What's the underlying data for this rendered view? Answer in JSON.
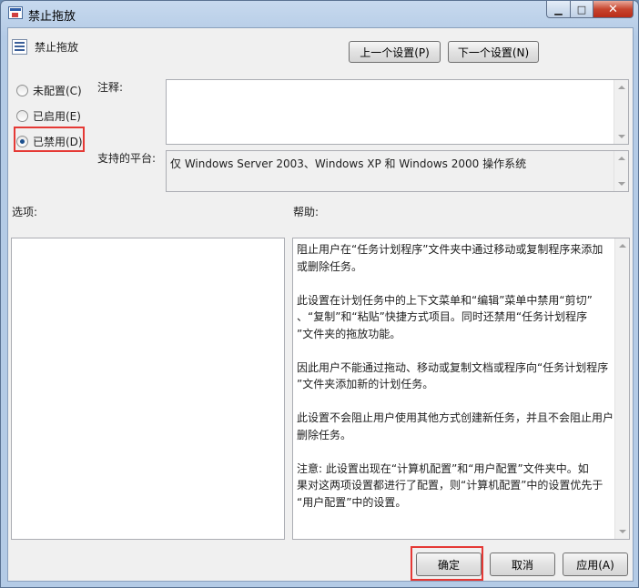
{
  "window": {
    "title": "禁止拖放",
    "minimize_glyph": "▁",
    "maximize_glyph": "□",
    "close_glyph": "✕"
  },
  "policy": {
    "name": "禁止拖放",
    "prev_button": "上一个设置(P)",
    "next_button": "下一个设置(N)"
  },
  "state": {
    "options": [
      {
        "label": "未配置(C)",
        "checked": false
      },
      {
        "label": "已启用(E)",
        "checked": false
      },
      {
        "label": "已禁用(D)",
        "checked": true
      }
    ]
  },
  "comment": {
    "label": "注释:",
    "value": ""
  },
  "platform": {
    "label": "支持的平台:",
    "value": "仅 Windows Server 2003、Windows XP 和 Windows 2000 操作系统"
  },
  "options_section": {
    "label": "选项:"
  },
  "help": {
    "label": "帮助:",
    "text": "阻止用户在“任务计划程序”文件夹中通过移动或复制程序来添加\n或删除任务。\n\n此设置在计划任务中的上下文菜单和“编辑”菜单中禁用“剪切”\n、“复制”和“粘贴”快捷方式项目。同时还禁用“任务计划程序\n”文件夹的拖放功能。\n\n因此用户不能通过拖动、移动或复制文档或程序向“任务计划程序\n”文件夹添加新的计划任务。\n\n此设置不会阻止用户使用其他方式创建新任务，并且不会阻止用户\n删除任务。\n\n注意: 此设置出现在“计算机配置”和“用户配置”文件夹中。如\n果对这两项设置都进行了配置，则“计算机配置”中的设置优先于\n“用户配置”中的设置。"
  },
  "footer": {
    "ok": "确定",
    "cancel": "取消",
    "apply": "应用(A)"
  },
  "colors": {
    "highlight": "#e53935"
  }
}
